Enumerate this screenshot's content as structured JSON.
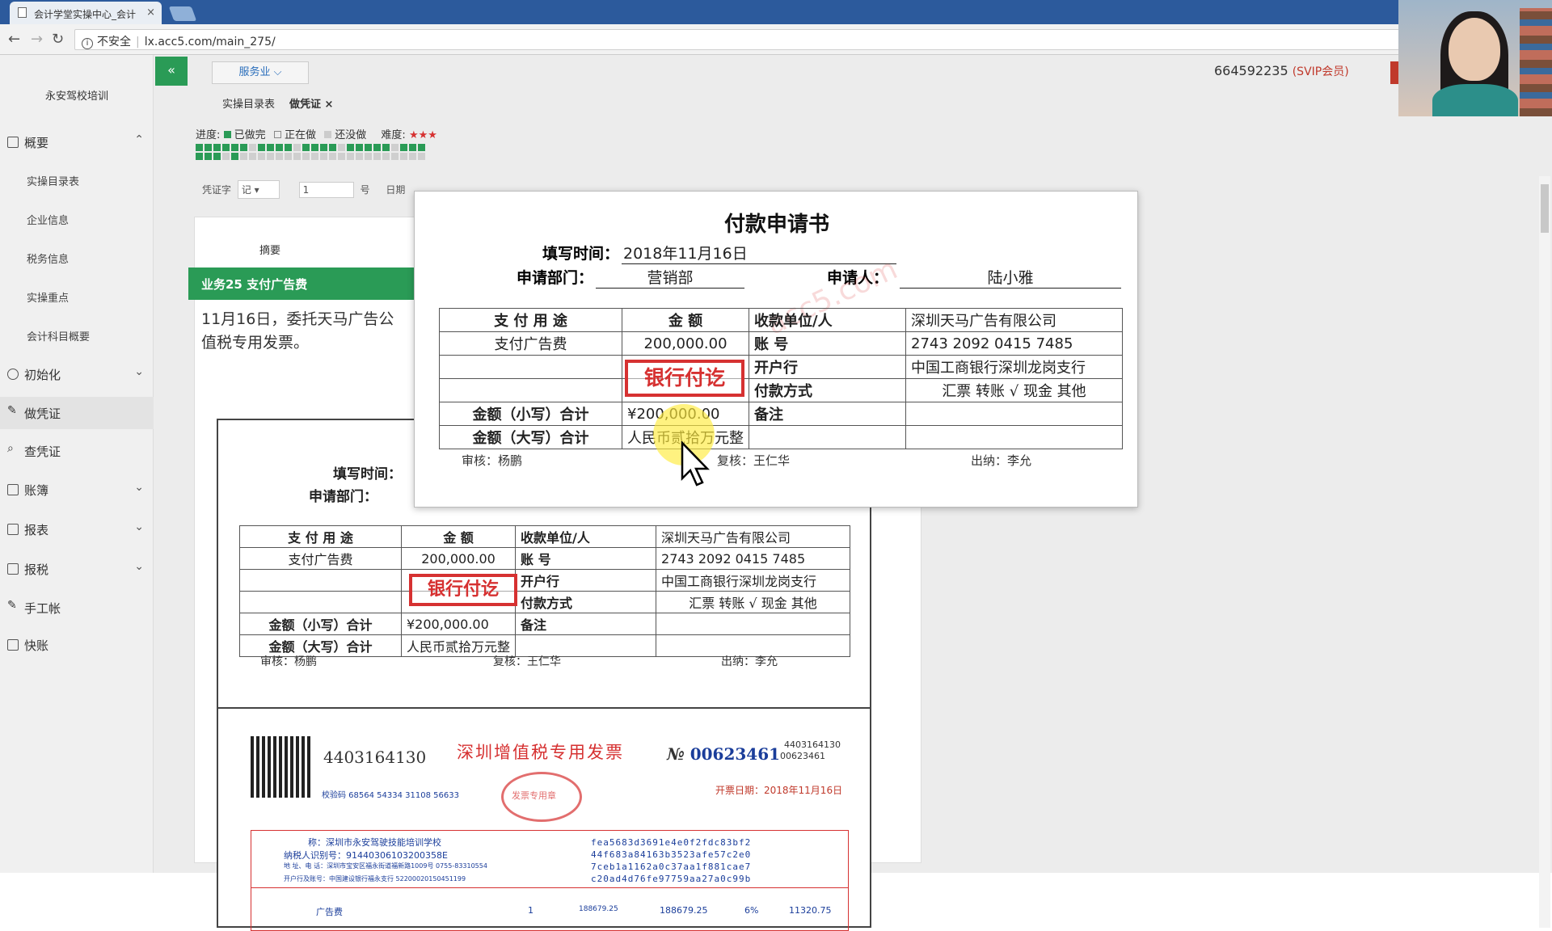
{
  "browser": {
    "tab_title": "会计学堂实操中心_会计",
    "tab_close": "×",
    "url_security": "不安全",
    "url": "lx.acc5.com/main_275/"
  },
  "sidebar": {
    "school_name": "永安驾校培训",
    "items": [
      {
        "label": "概要",
        "icon": "grid-icon",
        "expanded": true
      },
      {
        "label": "初始化",
        "icon": "gear-icon"
      },
      {
        "label": "做凭证",
        "icon": "pen-icon"
      },
      {
        "label": "查凭证",
        "icon": "search-icon"
      },
      {
        "label": "账簿",
        "icon": "book-icon"
      },
      {
        "label": "报表",
        "icon": "report-icon"
      },
      {
        "label": "报税",
        "icon": "file-icon"
      },
      {
        "label": "手工帐",
        "icon": "pen-icon"
      },
      {
        "label": "快账",
        "icon": "file-icon"
      }
    ],
    "subitems": [
      "实操目录表",
      "企业信息",
      "税务信息",
      "实操重点",
      "会计科目概要"
    ]
  },
  "header": {
    "collapse_label": "«",
    "service_label": "服务业 ⌵",
    "account_id": "664592235",
    "account_level": "(SVIP会员)"
  },
  "tabs": {
    "catalog": "实操目录表",
    "voucher": "做凭证",
    "voucher_close": "×"
  },
  "progress": {
    "label": "进度:",
    "done": "已做完",
    "doing": "正在做",
    "todo": "还没做",
    "difficulty": "难度:"
  },
  "voucher_form": {
    "word_label": "凭证字",
    "word_value": "记",
    "number_value": "1",
    "number_suffix": "号",
    "date_label": "日期"
  },
  "table_header": {
    "summary": "摘要"
  },
  "business": {
    "title": "业务25 支付广告费",
    "desc_line1": "11月16日，委托天马广告公",
    "desc_line2": "值税专用发票。"
  },
  "payment_form": {
    "title": "付款申请书",
    "fill_time_label": "填写时间：",
    "fill_time_value": "2018年11月16日",
    "dept_label": "申请部门：",
    "dept_value": "营销部",
    "applicant_label": "申请人：",
    "applicant_value": "陆小雅",
    "col_purpose": "支 付 用 途",
    "col_amount": "金 额",
    "col_payee": "收款单位/人",
    "purpose_value": "支付广告费",
    "amount_value": "200,000.00",
    "payee_value": "深圳天马广告有限公司",
    "account_label": "账 号",
    "account_value": "2743 2092 0415 7485",
    "bank_label": "开户行",
    "bank_value": "中国工商银行深圳龙岗支行",
    "paymethod_label": "付款方式",
    "paymethod_value": "汇票  转账 √  现金   其他",
    "stamp_text": "银行付讫",
    "small_total_label": "金额（小写）合计",
    "small_total_value": "¥200,000.00",
    "big_total_label": "金额（大写）合计",
    "big_total_value": "人民币贰拾万元整",
    "remark_label": "备注",
    "auditor": "审核：杨鹏",
    "reviewer": "复核：王仁华",
    "cashier": "出纳：李允",
    "watermark": "acc5.com"
  },
  "invoice": {
    "code": "4403164130",
    "title": "深圳增值税专用发票",
    "no_prefix": "№",
    "number": "00623461",
    "code_small": "4403164130",
    "number_small": "00623461",
    "issue_date": "开票日期：2018年11月16日",
    "check_code": "校验码 68564 54334 31108 56633",
    "buyer_name": "称：深圳市永安驾驶技能培训学校",
    "taxpayer_id": "纳税人识别号：91440306103200358E",
    "address": "地 址、电 话：深圳市宝安区福永街道福新路1009号 0755-83310554",
    "bank": "开户行及账号：中国建设银行福永支行 52200020150451199",
    "cipher1": "fea5683d3691e4e0f2fdc83bf2",
    "cipher2": "44f683a84163b3523afe57c2e0",
    "cipher3": "7ceb1a1162a0c37aa1f881cae7",
    "cipher4": "c20ad4d76fe97759aa27a0c99b",
    "item_name": "广告费",
    "qty": "1",
    "unit_price": "188679.25",
    "amount": "188679.25",
    "tax_rate": "6%",
    "tax": "11320.75",
    "seal_text": "发票专用章"
  },
  "colors": {
    "accent_green": "#2a9b56",
    "stamp_red": "#d63131",
    "invoice_blue": "#1a3d9a"
  }
}
